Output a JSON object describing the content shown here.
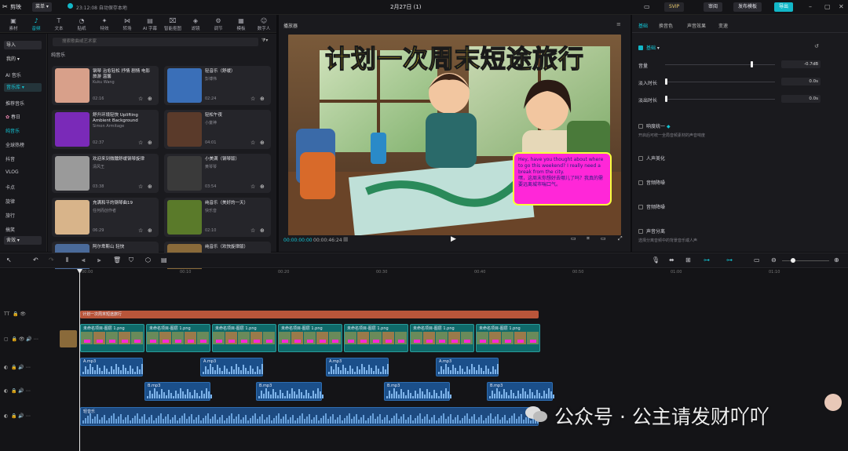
{
  "app": {
    "title": "剪映",
    "menu": "菜单",
    "status": "23:12:08 自动保存本地",
    "date": "2月27日 (1)",
    "svip": "SVIP",
    "review": "审阅",
    "publish": "发布模板",
    "export": "导出"
  },
  "top_tabs": [
    {
      "label": "素材",
      "icon": "▣"
    },
    {
      "label": "音频",
      "icon": "♪"
    },
    {
      "label": "文本",
      "icon": "T"
    },
    {
      "label": "贴纸",
      "icon": "◔"
    },
    {
      "label": "特效",
      "icon": "✦"
    },
    {
      "label": "转场",
      "icon": "⋈"
    },
    {
      "label": "AI 字幕",
      "icon": "▤"
    },
    {
      "label": "智能抠图",
      "icon": "⌧"
    },
    {
      "label": "滤镜",
      "icon": "◈"
    },
    {
      "label": "调节",
      "icon": "⚙"
    },
    {
      "label": "模板",
      "icon": "▦"
    },
    {
      "label": "数字人",
      "icon": "☺"
    }
  ],
  "left_nav": {
    "import": "导入",
    "mine": "我的",
    "ai_music": "AI 音乐",
    "music": "音乐库",
    "recommend": "推荐音乐",
    "spring": "春日",
    "pure": "纯音乐",
    "trending": "全球热榜",
    "douyin": "抖音",
    "vlog": "VLOG",
    "kadian": "卡点",
    "xuanlv": "旋律",
    "travel": "旅行",
    "funny": "搞笑",
    "more": "舍效"
  },
  "music_panel": {
    "search_placeholder": "搜索歌曲或艺术家",
    "filter": "全部",
    "section": "纯音乐",
    "cards": [
      {
        "title": "钢琴 治愈轻松 抒情 剧情 电影 旅游 温馨",
        "artist": "Kuku Wang",
        "duration": "02:16",
        "thumb": "#d8a08a"
      },
      {
        "title": "轻音乐（舒缓）",
        "artist": "彭博伟",
        "duration": "02:24",
        "thumb": "#3a6fb8"
      },
      {
        "title": "舒升环境轻快 Uplifting Ambient Background",
        "artist": "Simon Armitage",
        "duration": "02:37",
        "thumb": "#7a2ab8"
      },
      {
        "title": "轻松午夜",
        "artist": "小童神",
        "duration": "04:01",
        "thumb": "#5a3a2a"
      },
      {
        "title": "欢迎来到微醺舒缓钢琴旋律",
        "artist": "清风王",
        "duration": "03:38",
        "thumb": "#9a9a9a"
      },
      {
        "title": "小美满（钢琴版）",
        "artist": "黄琴琴",
        "duration": "03:54",
        "thumb": "#3a3a3a"
      },
      {
        "title": "充满和平的钢琴曲19",
        "artist": "任何而创作者",
        "duration": "06:29",
        "thumb": "#d8b48a"
      },
      {
        "title": "纯音乐（美好的一天）",
        "artist": "快乐音",
        "duration": "02:10",
        "thumb": "#5a7a2a"
      },
      {
        "title": "阿尔卑斯山 轻快",
        "artist": "",
        "duration": "",
        "thumb": "#4a6a9a"
      },
      {
        "title": "纯音乐（欢快旋律版）",
        "artist": "",
        "duration": "",
        "thumb": "#8a6a3a"
      }
    ]
  },
  "player": {
    "title": "播放器",
    "video_title": "计划一次周末短途旅行",
    "bubble_en": "Hey, have you thought about where to go this weekend? I really need a break from the city.",
    "bubble_cn": "嘿，这周末你想好去哪儿了吗？我真的需要远离城市喘口气。",
    "time_current": "00:00:00:00",
    "time_total": "00:00:46:24"
  },
  "props": {
    "tabs": [
      "基础",
      "换音色",
      "声音效果",
      "变速"
    ],
    "basic": "基础",
    "volume": "音量",
    "volume_val": "-0.7dB",
    "fade_in": "淡入时长",
    "fade_in_val": "0.0s",
    "fade_out": "淡出时长",
    "fade_out_val": "0.0s",
    "normalize": "响度统一",
    "normalize_desc": "开启后可统一全局音频素材的声音响度",
    "enhance": "人声美化",
    "dereverb": "音频降噪",
    "denoise": "音频降噪",
    "separate": "声音分离",
    "separate_desc": "选择分离音频中的背景音乐或人声"
  },
  "timeline": {
    "ruler_ticks": [
      "00:00",
      "00:10",
      "00:20",
      "00:30",
      "00:40",
      "00:50",
      "01:00",
      "01:10"
    ],
    "text_clip": "计划一次周末短途旅行",
    "video_label": "未命名项目-图层 1.png",
    "bgm_label": "轻音乐",
    "track_a": [
      "A.mp3",
      "A.mp3",
      "A.mp3",
      "A.mp3"
    ],
    "track_b": [
      "B.mp3",
      "B.mp3",
      "B.mp3",
      "B.mp3"
    ]
  },
  "watermark": "公众号 · 公主请发财吖吖"
}
